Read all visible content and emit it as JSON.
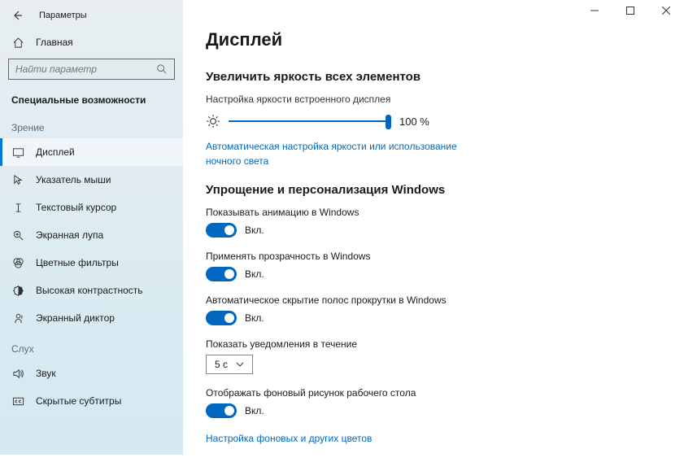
{
  "window": {
    "title": "Параметры"
  },
  "home": {
    "label": "Главная"
  },
  "search": {
    "placeholder": "Найти параметр"
  },
  "category": {
    "label": "Специальные возможности"
  },
  "groups": {
    "vision": {
      "label": "Зрение",
      "items": [
        {
          "key": "display",
          "label": "Дисплей"
        },
        {
          "key": "cursor",
          "label": "Указатель мыши"
        },
        {
          "key": "textcursor",
          "label": "Текстовый курсор"
        },
        {
          "key": "magnifier",
          "label": "Экранная лупа"
        },
        {
          "key": "colorfilters",
          "label": "Цветные фильтры"
        },
        {
          "key": "highcontrast",
          "label": "Высокая контрастность"
        },
        {
          "key": "narrator",
          "label": "Экранный диктор"
        }
      ]
    },
    "hearing": {
      "label": "Слух",
      "items": [
        {
          "key": "audio",
          "label": "Звук"
        },
        {
          "key": "captions",
          "label": "Скрытые субтитры"
        }
      ]
    }
  },
  "page": {
    "title": "Дисплей",
    "brightness": {
      "heading": "Увеличить яркость всех элементов",
      "sub": "Настройка яркости встроенного дисплея",
      "value": "100 %",
      "link": "Автоматическая настройка яркости или использование ночного света"
    },
    "simplify": {
      "heading": "Упрощение и персонализация Windows",
      "toggles": [
        {
          "label": "Показывать анимацию в Windows",
          "state": "Вкл."
        },
        {
          "label": "Применять прозрачность в Windows",
          "state": "Вкл."
        },
        {
          "label": "Автоматическое скрытие полос прокрутки в Windows",
          "state": "Вкл."
        }
      ],
      "notify": {
        "label": "Показать уведомления в течение",
        "value": "5 с"
      },
      "bg": {
        "label": "Отображать фоновый рисунок рабочего стола",
        "state": "Вкл."
      },
      "link": "Настройка фоновых и других цветов"
    }
  }
}
